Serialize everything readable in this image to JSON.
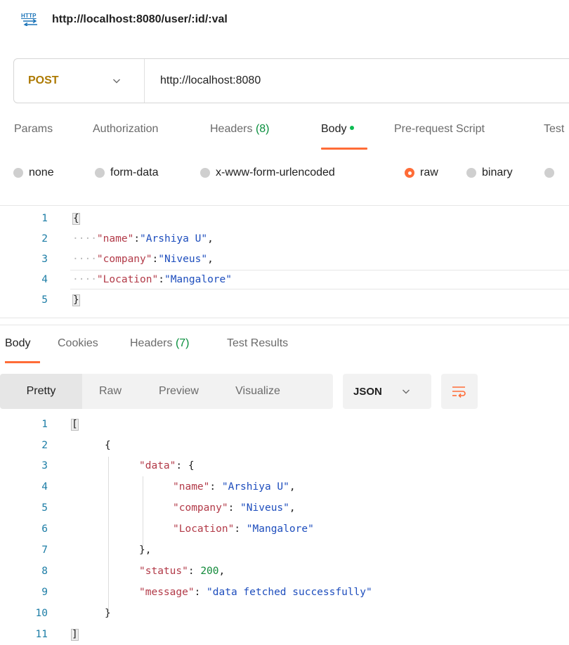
{
  "title": {
    "icon": "http-icon",
    "icon_text": "HTTP",
    "text": "http://localhost:8080/user/:id/:val"
  },
  "request": {
    "method": "POST",
    "url": "http://localhost:8080",
    "tabs": [
      {
        "label": "Params"
      },
      {
        "label": "Authorization"
      },
      {
        "label": "Headers",
        "count": "(8)"
      },
      {
        "label": "Body"
      },
      {
        "label": "Pre-request Script"
      },
      {
        "label": "Test"
      }
    ],
    "body_types": [
      "none",
      "form-data",
      "x-www-form-urlencoded",
      "raw",
      "binary"
    ],
    "selected_body_type": "raw",
    "body_lines": [
      {
        "n": "1",
        "text": "{"
      },
      {
        "n": "2",
        "key": "\"name\"",
        "val": "\"Arshiya U\""
      },
      {
        "n": "3",
        "key": "\"company\"",
        "val": "\"Niveus\""
      },
      {
        "n": "4",
        "key": "\"Location\"",
        "val": "\"Mangalore\""
      },
      {
        "n": "5",
        "text": "}"
      }
    ]
  },
  "response": {
    "tabs": [
      {
        "label": "Body"
      },
      {
        "label": "Cookies"
      },
      {
        "label": "Headers",
        "count": "(7)"
      },
      {
        "label": "Test Results"
      }
    ],
    "views": [
      "Pretty",
      "Raw",
      "Preview",
      "Visualize"
    ],
    "active_view": "Pretty",
    "format": "JSON",
    "lines": [
      {
        "n": "1",
        "text": "["
      },
      {
        "n": "2",
        "text": "{"
      },
      {
        "n": "3",
        "key": "\"data\"",
        "text": "{"
      },
      {
        "n": "4",
        "key": "\"name\"",
        "val": "\"Arshiya U\""
      },
      {
        "n": "5",
        "key": "\"company\"",
        "val": "\"Niveus\""
      },
      {
        "n": "6",
        "key": "\"Location\"",
        "val": "\"Mangalore\""
      },
      {
        "n": "7",
        "text": "},"
      },
      {
        "n": "8",
        "key": "\"status\"",
        "val": "200"
      },
      {
        "n": "9",
        "key": "\"message\"",
        "val": "\"data fetched successfully\""
      },
      {
        "n": "10",
        "text": "}"
      },
      {
        "n": "11",
        "text": "]"
      }
    ]
  },
  "colors": {
    "accent": "#ff6c37",
    "method": "#ad7a03",
    "key": "#b23a48",
    "string": "#1d4dbd",
    "number": "#128a3a",
    "line_number": "#1c7da6"
  }
}
